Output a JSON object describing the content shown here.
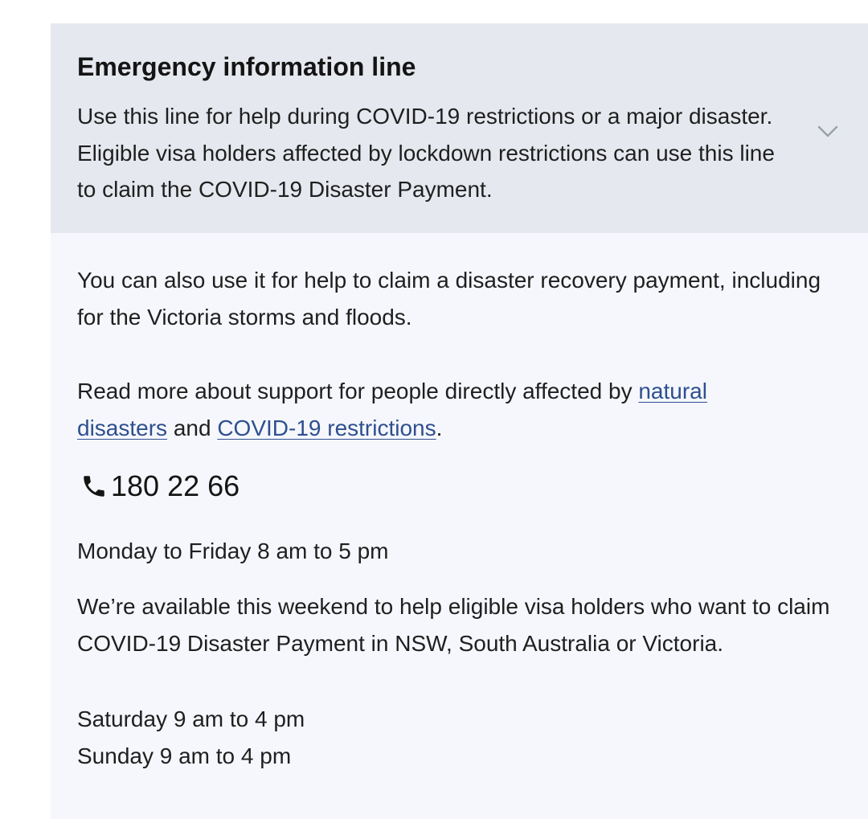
{
  "accordion": {
    "title": "Emergency information line",
    "summary": "Use this line for help during COVID-19 restrictions or a major disaster. Eligible visa holders affected by lockdown restrictions can use this line to claim the COVID-19 Disaster Payment.",
    "expand_icon": "chevron-down-icon",
    "colors": {
      "header_bg": "#e5e8ee",
      "body_bg": "#f5f7fc",
      "link": "#2e4f8f"
    }
  },
  "body": {
    "intro": "You can also use it for help to claim a disaster recovery payment, including for the Victoria storms and floods.",
    "read_more_prefix": "Read more about support for people directly affected by ",
    "link_natural_disasters": "natural disasters",
    "read_more_middle": " and ",
    "link_covid_restrictions": "COVID-19 restrictions",
    "read_more_suffix": ".",
    "phone_icon": "phone-icon",
    "phone_number": "180 22 66",
    "weekday_hours": "Monday to Friday 8 am to 5 pm",
    "weekend_note": "We’re available this weekend to help eligible visa holders who want to claim COVID-19 Disaster Payment in NSW, South Australia or Victoria.",
    "saturday_hours": "Saturday 9 am to 4 pm",
    "sunday_hours": "Sunday 9 am to 4 pm"
  }
}
